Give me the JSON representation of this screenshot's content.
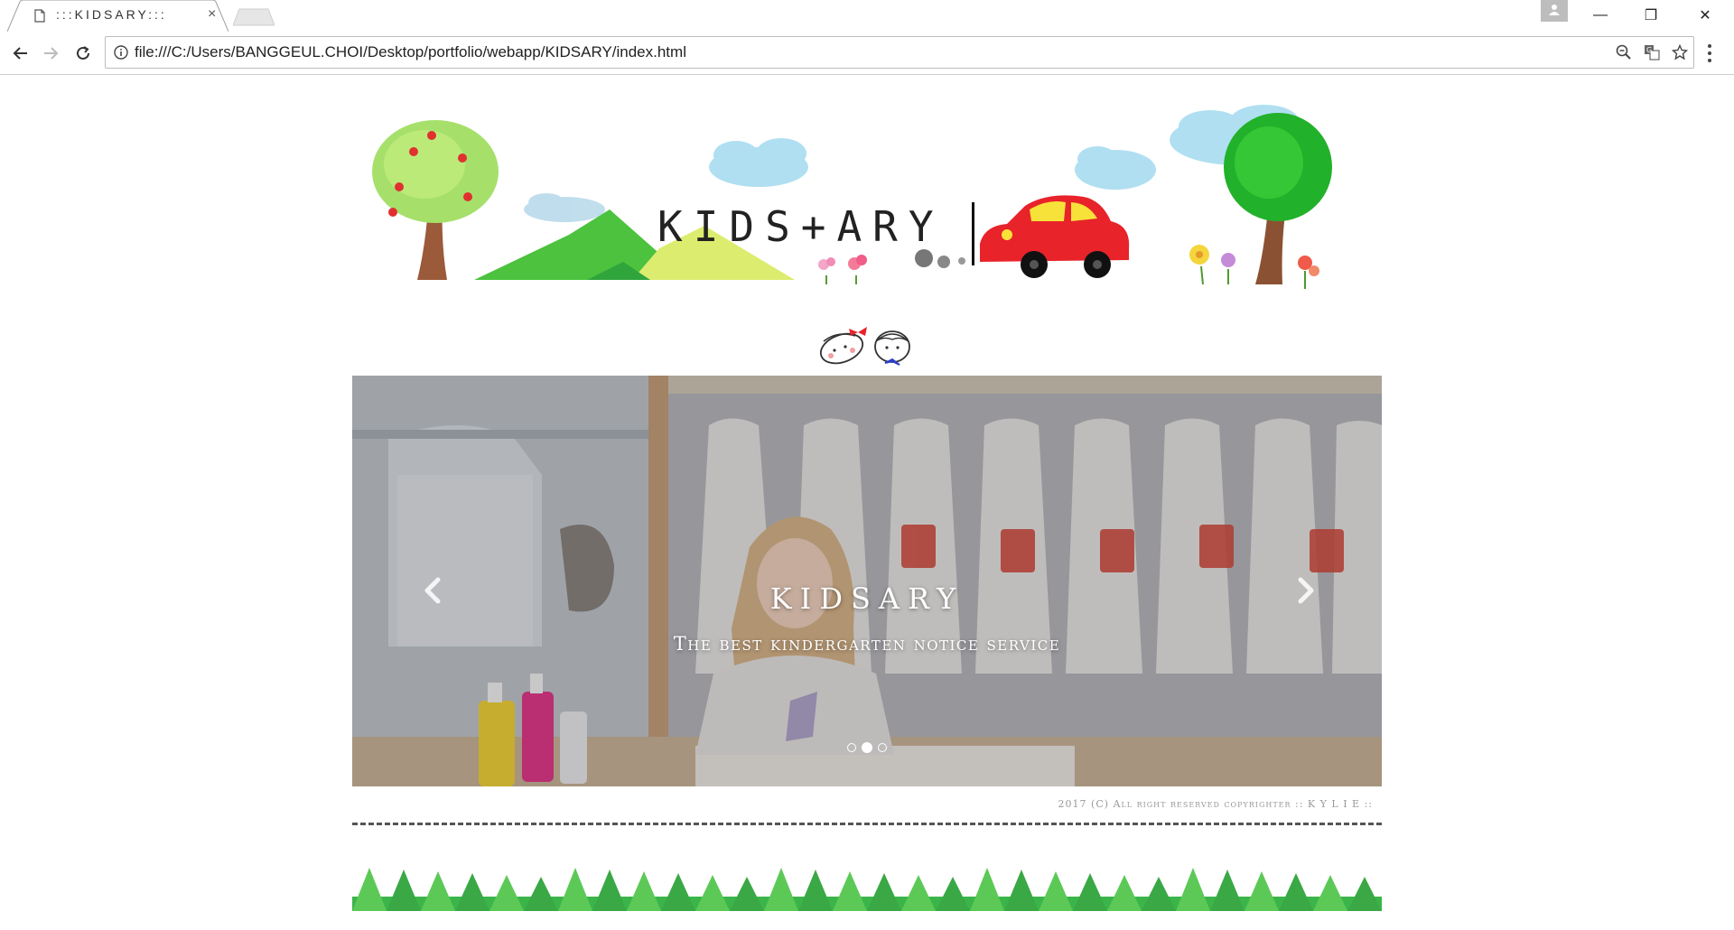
{
  "browser": {
    "tab_title": ":::KIDSARY:::",
    "tab_close": "×",
    "url": "file:///C:/Users/BANGGEUL.CHOI/Desktop/portfolio/webapp/KIDSARY/index.html",
    "window_minimize": "—",
    "window_restore": "❐",
    "window_close": "✕"
  },
  "header": {
    "logo_text": "KIDS+ARY"
  },
  "slider": {
    "title": "KIDSARY",
    "subtitle": "The best kindergarten notice service",
    "slide_count": 3,
    "active_slide": 2
  },
  "footer": {
    "copyright": "2017 (C) All right reserved copyrighter :: K Y L I E ::"
  },
  "colors": {
    "grass": "#3bb54a",
    "car": "#e8232a",
    "tree_green": "#7ed957",
    "sky": "#a8dcf0"
  },
  "icons": [
    "page-icon",
    "new-tab-icon",
    "profile-icon",
    "back-icon",
    "forward-icon",
    "reload-icon",
    "info-icon",
    "zoom-icon",
    "translate-icon",
    "star-icon",
    "menu-icon",
    "chevron-left-icon",
    "chevron-right-icon"
  ]
}
